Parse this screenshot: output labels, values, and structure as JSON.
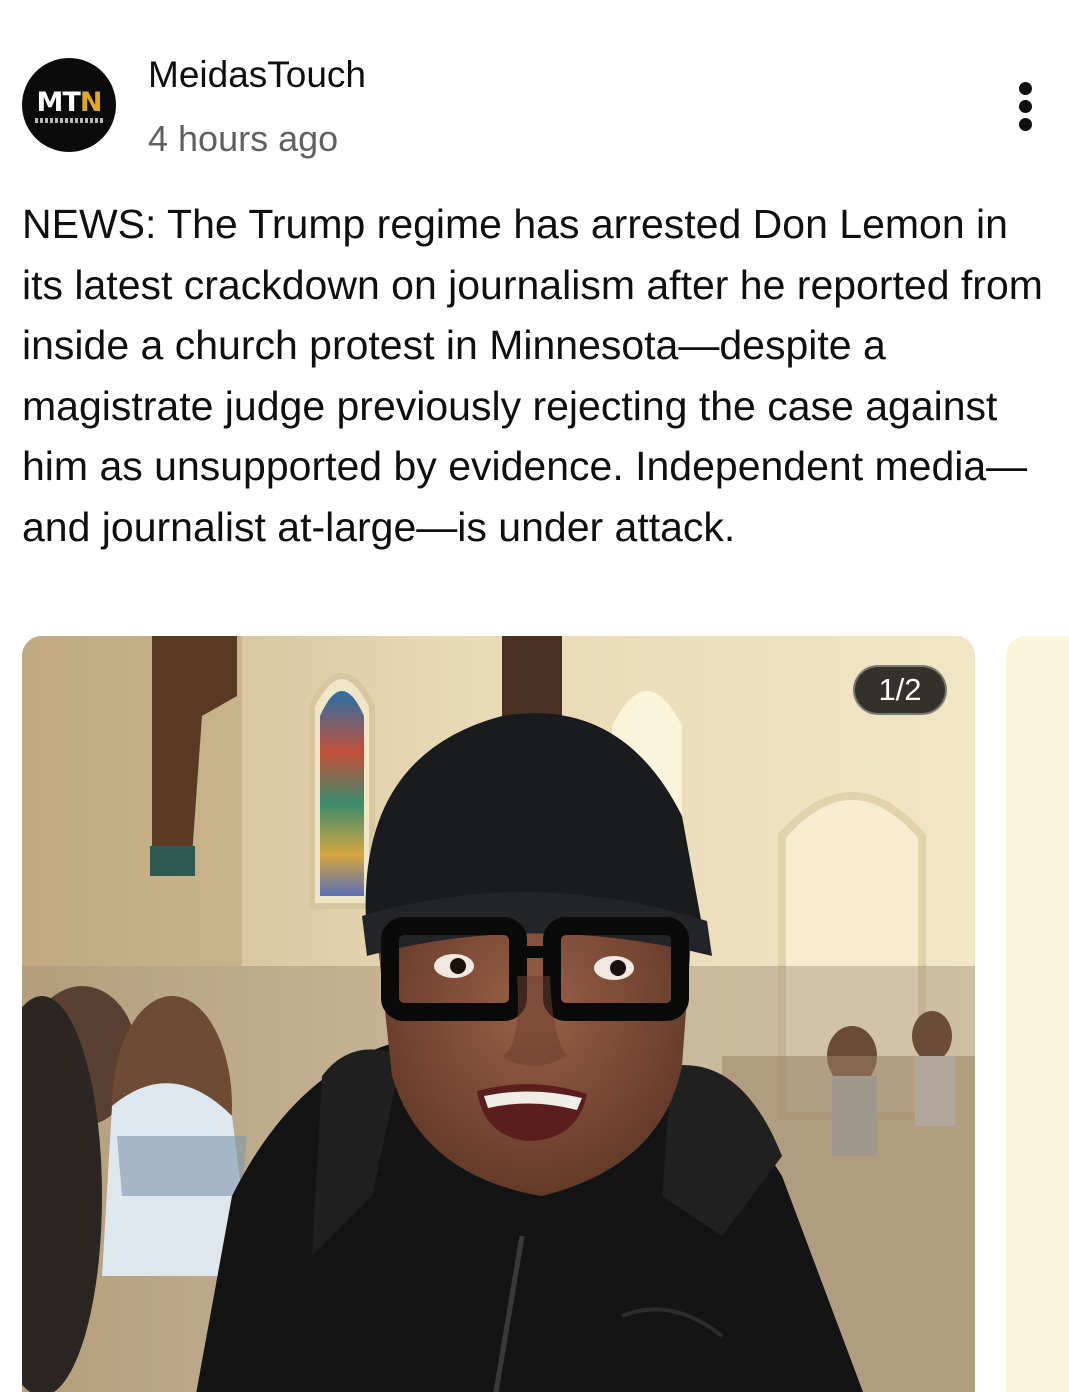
{
  "post": {
    "channel": {
      "name": "MeidasTouch",
      "avatar_text_main": "MT",
      "avatar_text_accent": "N",
      "avatar_subtext": "MEIDASTOUCH NETWORK"
    },
    "timestamp": "4 hours ago",
    "menu_icon": "more-vertical-icon",
    "text": "NEWS: The Trump regime has arrested Don Lemon in its latest crackdown on journalism after he reported from inside a church protest in Minnesota—despite a magistrate judge previously rejecting the case against him as unsupported by evidence. Independent media—and journalist at-large—is under attack.",
    "carousel": {
      "counter": "1/2",
      "current_index": 1,
      "total": 2
    }
  },
  "colors": {
    "text_primary": "#0f0f0f",
    "text_secondary": "#606060",
    "avatar_bg": "#0b0b0b",
    "avatar_accent": "#e0a81e",
    "badge_bg": "#19191a"
  }
}
